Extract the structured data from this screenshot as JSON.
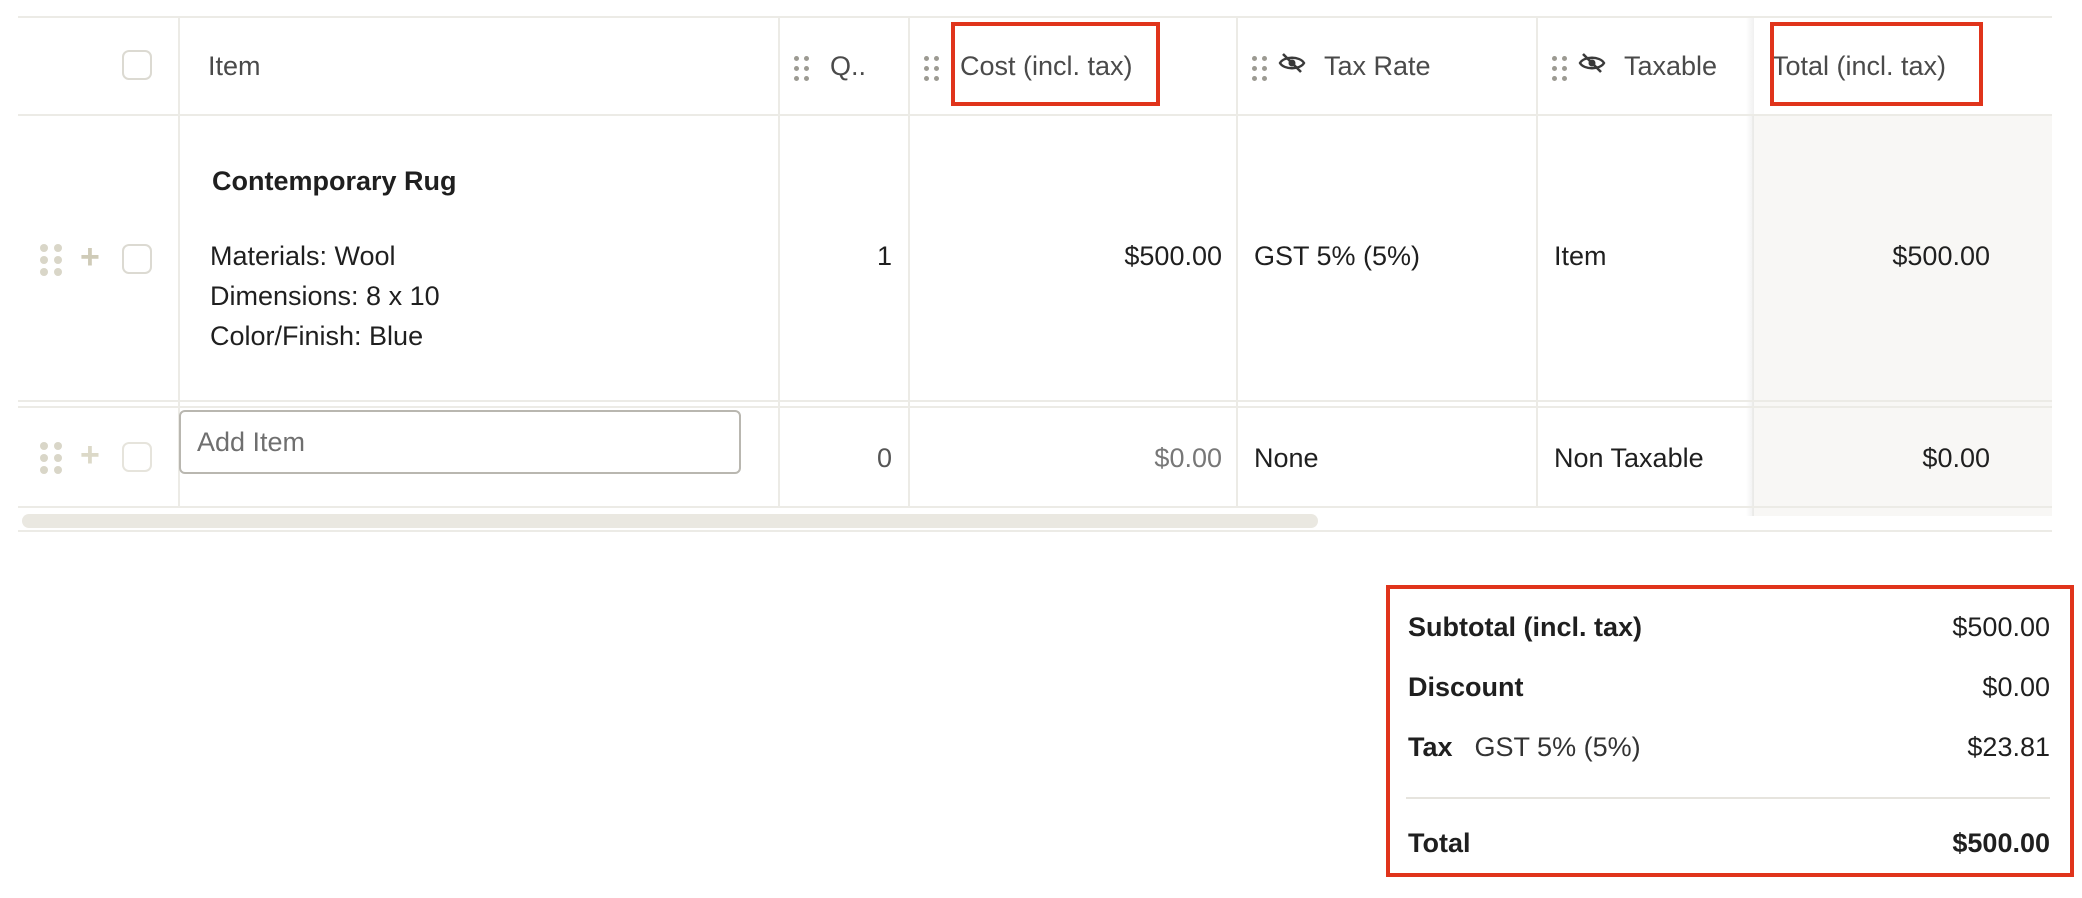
{
  "columns": {
    "item": "Item",
    "qty": "Q..",
    "cost": "Cost (incl. tax)",
    "tax_rate": "Tax Rate",
    "taxable": "Taxable",
    "total": "Total (incl. tax)"
  },
  "rows": [
    {
      "name": "Contemporary Rug",
      "details": [
        "Materials: Wool",
        "Dimensions: 8 x 10",
        "Color/Finish: Blue"
      ],
      "qty": "1",
      "cost": "$500.00",
      "tax_rate": "GST 5% (5%)",
      "taxable": "Item",
      "total": "$500.00"
    }
  ],
  "new_row": {
    "placeholder": "Add Item",
    "qty": "0",
    "cost": "$0.00",
    "tax_rate": "None",
    "taxable": "Non Taxable",
    "total": "$0.00"
  },
  "summary": {
    "subtotal_label": "Subtotal (incl. tax)",
    "subtotal_value": "$500.00",
    "discount_label": "Discount",
    "discount_value": "$0.00",
    "tax_label": "Tax",
    "tax_rate": "GST 5% (5%)",
    "tax_value": "$23.81",
    "total_label": "Total",
    "total_value": "$500.00"
  },
  "icons": {
    "hidden_column": "eye-off-icon",
    "drag_handle": "drag-handle-icon",
    "add_row": "plus-icon"
  },
  "colors": {
    "highlight": "#e0341b",
    "grid_line": "#ecebe6",
    "total_column_bg": "#f8f7f5"
  }
}
